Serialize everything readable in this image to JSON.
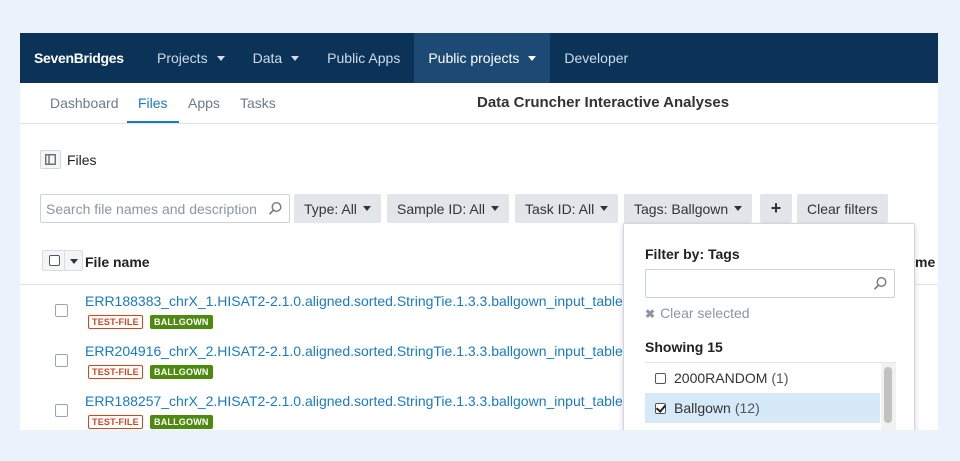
{
  "nav": {
    "brand": "SevenBridges",
    "items": [
      {
        "label": "Projects",
        "has_caret": true
      },
      {
        "label": "Data",
        "has_caret": true
      },
      {
        "label": "Public Apps",
        "has_caret": false
      },
      {
        "label": "Public projects",
        "has_caret": true,
        "active": true
      },
      {
        "label": "Developer",
        "has_caret": false
      }
    ]
  },
  "subnav": {
    "tabs": [
      "Dashboard",
      "Files",
      "Apps",
      "Tasks"
    ],
    "active_tab": "Files",
    "project_title": "Data Cruncher Interactive Analyses"
  },
  "files": {
    "title": "Files",
    "search_placeholder": "Search file names and description"
  },
  "filters": {
    "type": "Type: All",
    "sample_id": "Sample ID: All",
    "task_id": "Task ID: All",
    "tags": "Tags: Ballgown",
    "add": "+",
    "clear": "Clear filters"
  },
  "table": {
    "col_file_name": "File name",
    "col_partial": "me",
    "rows": [
      {
        "name": "ERR188383_chrX_1.HISAT2-2.1.0.aligned.sorted.StringTie.1.3.3.ballgown_input_table",
        "tags": [
          "TEST-FILE",
          "BALLGOWN"
        ]
      },
      {
        "name": "ERR204916_chrX_2.HISAT2-2.1.0.aligned.sorted.StringTie.1.3.3.ballgown_input_table",
        "tags": [
          "TEST-FILE",
          "BALLGOWN"
        ]
      },
      {
        "name": "ERR188257_chrX_2.HISAT2-2.1.0.aligned.sorted.StringTie.1.3.3.ballgown_input_table",
        "tags": [
          "TEST-FILE",
          "BALLGOWN"
        ]
      }
    ]
  },
  "tag_dropdown": {
    "title": "Filter by: Tags",
    "search_value": "",
    "clear_label": "Clear selected",
    "showing": "Showing 15",
    "items": [
      {
        "label": "2000RANDOM",
        "count": "(1)",
        "checked": false
      },
      {
        "label": "Ballgown",
        "count": "(12)",
        "checked": true
      }
    ]
  },
  "colors": {
    "nav_bg": "#0b3358",
    "nav_active": "#1c4a74",
    "link": "#1a7ac4",
    "tag_test": "#d0461c",
    "tag_ballgown": "#4e8a10",
    "selected_row": "#d6e9f8"
  },
  "icons": {
    "search": "magnifier-icon",
    "panel": "sidebar-toggle-icon",
    "clear": "x-icon",
    "caret": "chevron-down-icon"
  }
}
